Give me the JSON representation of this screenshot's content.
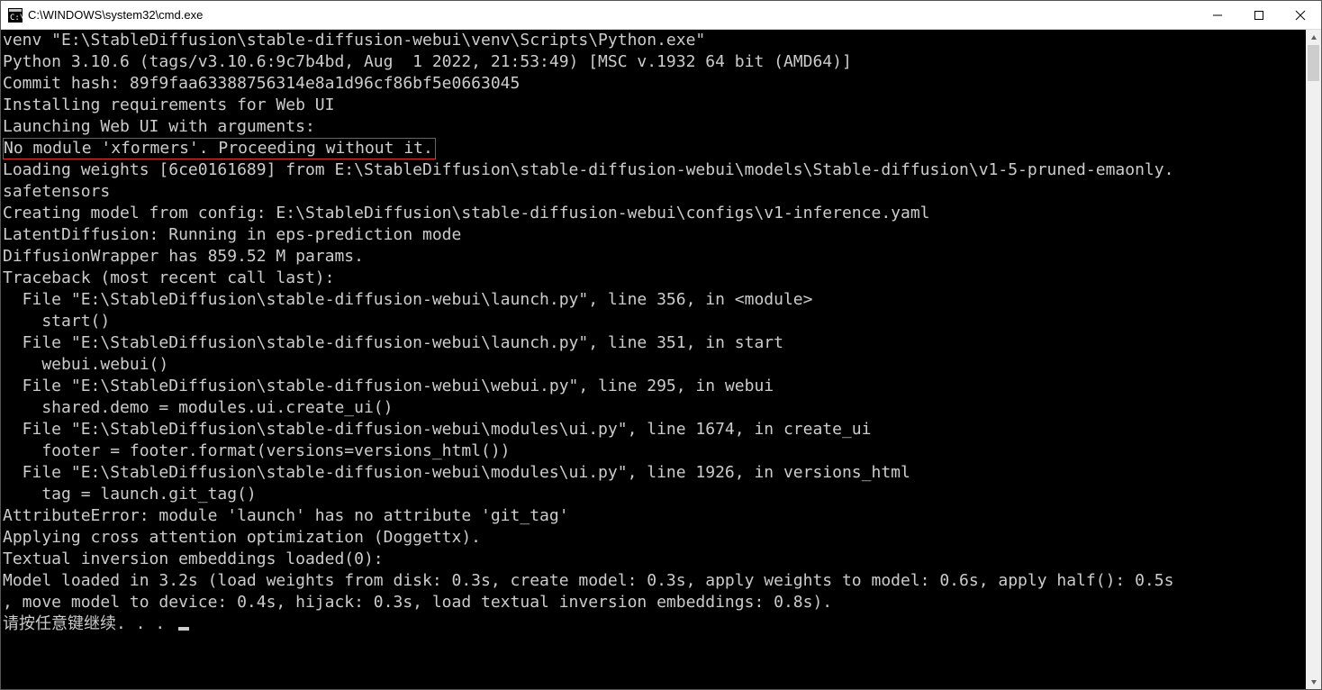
{
  "window": {
    "title": "C:\\WINDOWS\\system32\\cmd.exe"
  },
  "terminal": {
    "lines": [
      "venv \"E:\\StableDiffusion\\stable-diffusion-webui\\venv\\Scripts\\Python.exe\"",
      "Python 3.10.6 (tags/v3.10.6:9c7b4bd, Aug  1 2022, 21:53:49) [MSC v.1932 64 bit (AMD64)]",
      "Commit hash: 89f9faa63388756314e8a1d96cf86bf5e0663045",
      "Installing requirements for Web UI",
      "Launching Web UI with arguments:",
      "No module 'xformers'. Proceeding without it.",
      "Loading weights [6ce0161689] from E:\\StableDiffusion\\stable-diffusion-webui\\models\\Stable-diffusion\\v1-5-pruned-emaonly.",
      "safetensors",
      "Creating model from config: E:\\StableDiffusion\\stable-diffusion-webui\\configs\\v1-inference.yaml",
      "LatentDiffusion: Running in eps-prediction mode",
      "DiffusionWrapper has 859.52 M params.",
      "Traceback (most recent call last):",
      "  File \"E:\\StableDiffusion\\stable-diffusion-webui\\launch.py\", line 356, in <module>",
      "    start()",
      "  File \"E:\\StableDiffusion\\stable-diffusion-webui\\launch.py\", line 351, in start",
      "    webui.webui()",
      "  File \"E:\\StableDiffusion\\stable-diffusion-webui\\webui.py\", line 295, in webui",
      "    shared.demo = modules.ui.create_ui()",
      "  File \"E:\\StableDiffusion\\stable-diffusion-webui\\modules\\ui.py\", line 1674, in create_ui",
      "    footer = footer.format(versions=versions_html())",
      "  File \"E:\\StableDiffusion\\stable-diffusion-webui\\modules\\ui.py\", line 1926, in versions_html",
      "    tag = launch.git_tag()",
      "AttributeError: module 'launch' has no attribute 'git_tag'",
      "Applying cross attention optimization (Doggettx).",
      "Textual inversion embeddings loaded(0):",
      "Model loaded in 3.2s (load weights from disk: 0.3s, create model: 0.3s, apply weights to model: 0.6s, apply half(): 0.5s",
      ", move model to device: 0.4s, hijack: 0.3s, load textual inversion embeddings: 0.8s).",
      "请按任意键继续. . . "
    ],
    "highlight_index": 5,
    "cursor_after_index": 27
  }
}
